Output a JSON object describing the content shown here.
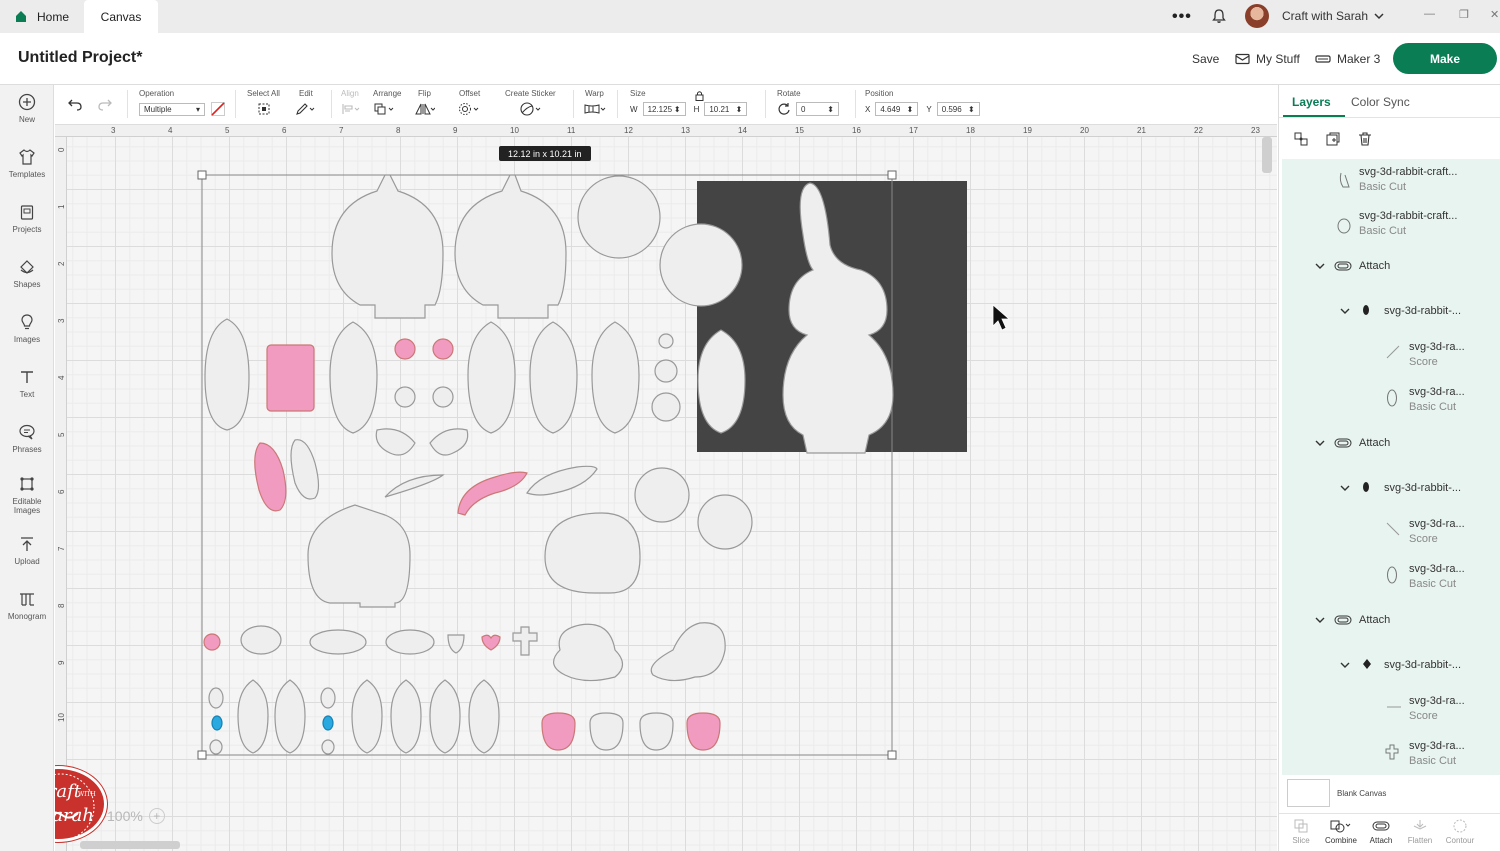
{
  "titlebar": {
    "tabs": [
      {
        "label": "Home"
      },
      {
        "label": "Canvas"
      }
    ],
    "account_name": "Craft with Sarah",
    "more_label": "•••"
  },
  "header": {
    "project_title": "Untitled Project*",
    "save_label": "Save",
    "my_stuff_label": "My Stuff",
    "machine_label": "Maker 3",
    "make_label": "Make"
  },
  "leftbar": {
    "items": [
      {
        "label": "New",
        "icon": "plus-circle-icon"
      },
      {
        "label": "Templates",
        "icon": "shirt-icon"
      },
      {
        "label": "Projects",
        "icon": "projects-icon"
      },
      {
        "label": "Shapes",
        "icon": "shapes-icon"
      },
      {
        "label": "Images",
        "icon": "lightbulb-icon"
      },
      {
        "label": "Text",
        "icon": "text-icon"
      },
      {
        "label": "Phrases",
        "icon": "speech-bubble-icon"
      },
      {
        "label": "Editable Images",
        "icon": "editable-images-icon"
      },
      {
        "label": "Upload",
        "icon": "upload-icon"
      },
      {
        "label": "Monogram",
        "icon": "monogram-icon"
      }
    ]
  },
  "toolbar": {
    "operation_label": "Operation",
    "operation_value": "Multiple",
    "select_all_label": "Select All",
    "edit_label": "Edit",
    "align_label": "Align",
    "arrange_label": "Arrange",
    "flip_label": "Flip",
    "offset_label": "Offset",
    "create_sticker_label": "Create Sticker",
    "warp_label": "Warp",
    "size_label": "Size",
    "w_label": "W",
    "w_value": "12.125",
    "h_label": "H",
    "h_value": "10.21",
    "rotate_label": "Rotate",
    "rotate_value": "0",
    "position_label": "Position",
    "x_label": "X",
    "x_value": "4.649",
    "y_label": "Y",
    "y_value": "0.596"
  },
  "canvas": {
    "ruler_top": [
      "3",
      "4",
      "5",
      "6",
      "7",
      "8",
      "9",
      "10",
      "11",
      "12",
      "13",
      "14",
      "15",
      "16",
      "17",
      "18",
      "19",
      "20",
      "21",
      "22",
      "23"
    ],
    "ruler_left": [
      "0",
      "1",
      "2",
      "3",
      "4",
      "5",
      "6",
      "7",
      "8",
      "9",
      "10"
    ],
    "dimension_badge": "12.12  in x 10.21  in",
    "zoom_label": "100%",
    "logo_line1": "Craft",
    "logo_with": "WITH",
    "logo_line2": "Sarah",
    "colors": {
      "pink": "#f09bbf",
      "blue": "#29a9e0",
      "dark": "#444444",
      "shape": "#eeeeee",
      "outline": "#888888"
    }
  },
  "rightpanel": {
    "tab_layers": "Layers",
    "tab_color_sync": "Color Sync",
    "layers": [
      {
        "name": "svg-3d-rabbit-craft...",
        "op": "Basic Cut"
      },
      {
        "name": "svg-3d-rabbit-craft...",
        "op": "Basic Cut"
      },
      {
        "name": "Attach"
      },
      {
        "name": "svg-3d-rabbit-..."
      },
      {
        "name": "svg-3d-ra...",
        "op": "Score"
      },
      {
        "name": "svg-3d-ra...",
        "op": "Basic Cut"
      },
      {
        "name": "Attach"
      },
      {
        "name": "svg-3d-rabbit-..."
      },
      {
        "name": "svg-3d-ra...",
        "op": "Score"
      },
      {
        "name": "svg-3d-ra...",
        "op": "Basic Cut"
      },
      {
        "name": "Attach"
      },
      {
        "name": "svg-3d-rabbit-..."
      },
      {
        "name": "svg-3d-ra...",
        "op": "Score"
      },
      {
        "name": "svg-3d-ra...",
        "op": "Basic Cut"
      }
    ],
    "blank_canvas_label": "Blank Canvas",
    "bottom_actions": [
      {
        "label": "Slice",
        "active": false
      },
      {
        "label": "Combine",
        "active": true
      },
      {
        "label": "Attach",
        "active": true
      },
      {
        "label": "Flatten",
        "active": false
      },
      {
        "label": "Contour",
        "active": false
      }
    ]
  }
}
